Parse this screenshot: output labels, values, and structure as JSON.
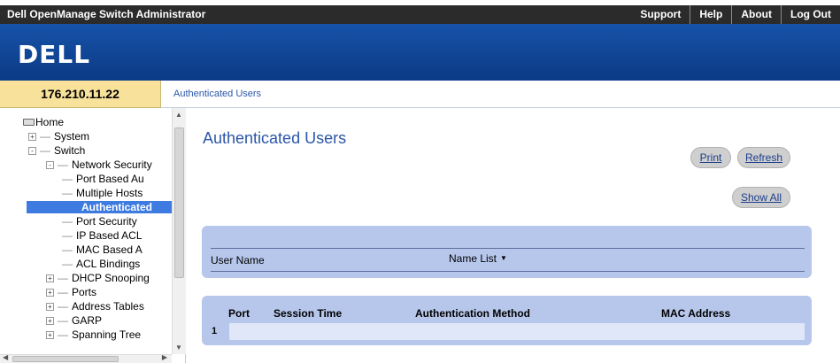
{
  "header": {
    "app_title": "Dell OpenManage Switch Administrator",
    "links": [
      "Support",
      "Help",
      "About",
      "Log Out"
    ],
    "logo": "DELL"
  },
  "device": {
    "ip": "176.210.11.22"
  },
  "breadcrumb": "Authenticated Users",
  "sidebar": {
    "items": [
      {
        "label": "Home",
        "icon": "folder-icon"
      },
      {
        "label": "System",
        "toggle": "+"
      },
      {
        "label": "Switch",
        "toggle": "-"
      },
      {
        "label": "Network Security",
        "toggle": "-"
      },
      {
        "label": "Port Based Au"
      },
      {
        "label": "Multiple Hosts"
      },
      {
        "label": "Authenticated"
      },
      {
        "label": "Port Security"
      },
      {
        "label": "IP Based ACL"
      },
      {
        "label": "MAC Based A"
      },
      {
        "label": "ACL Bindings"
      },
      {
        "label": "DHCP Snooping",
        "toggle": "+"
      },
      {
        "label": "Ports",
        "toggle": "+"
      },
      {
        "label": "Address Tables",
        "toggle": "+"
      },
      {
        "label": "GARP",
        "toggle": "+"
      },
      {
        "label": "Spanning Tree",
        "toggle": "+"
      }
    ]
  },
  "main": {
    "title": "Authenticated Users",
    "buttons": {
      "print": "Print",
      "refresh": "Refresh",
      "show_all": "Show All"
    },
    "filter": {
      "label": "User Name",
      "select_value": "Name List"
    },
    "table": {
      "columns": [
        "Port",
        "Session Time",
        "Authentication Method",
        "MAC Address"
      ],
      "rows": [
        {
          "index": "1"
        }
      ]
    }
  }
}
